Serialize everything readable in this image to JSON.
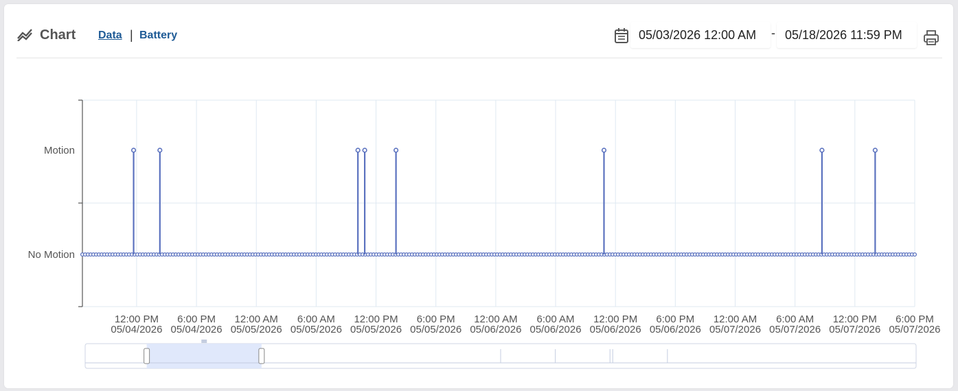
{
  "header": {
    "title": "Chart",
    "tabs": {
      "data": "Data",
      "separator": "|",
      "battery": "Battery"
    },
    "date_start": "05/03/2026 12:00 AM",
    "date_separator": "-",
    "date_end": "05/18/2026 11:59 PM",
    "icons": {
      "chart": "chart-line-icon",
      "calendar": "calendar-icon",
      "print": "print-icon"
    }
  },
  "colors": {
    "series": "#5b72bf",
    "grid": "#dfe9f2",
    "axis": "#555555",
    "link": "#1f5b96",
    "navigator_fill": "#dde6fb"
  },
  "chart_data": {
    "type": "line",
    "step": true,
    "y_categories": [
      "No Motion",
      "Motion"
    ],
    "x_ticks": [
      [
        "12:00 PM",
        "05/04/2026"
      ],
      [
        "6:00 PM",
        "05/04/2026"
      ],
      [
        "12:00 AM",
        "05/05/2026"
      ],
      [
        "6:00 AM",
        "05/05/2026"
      ],
      [
        "12:00 PM",
        "05/05/2026"
      ],
      [
        "6:00 PM",
        "05/05/2026"
      ],
      [
        "12:00 AM",
        "05/06/2026"
      ],
      [
        "6:00 AM",
        "05/06/2026"
      ],
      [
        "12:00 PM",
        "05/06/2026"
      ],
      [
        "6:00 PM",
        "05/06/2026"
      ],
      [
        "12:00 AM",
        "05/07/2026"
      ],
      [
        "6:00 AM",
        "05/07/2026"
      ],
      [
        "12:00 PM",
        "05/07/2026"
      ],
      [
        "6:00 PM",
        "05/07/2026"
      ]
    ],
    "x_range": [
      "05/04/2026 6:34 AM",
      "05/07/2026 6:00 PM"
    ],
    "baseline_value": "No Motion",
    "motion_events": [
      "05/04/2026 11:42 AM",
      "05/04/2026 2:20 PM",
      "05/05/2026 10:11 AM",
      "05/05/2026 10:52 AM",
      "05/05/2026 2:00 PM",
      "05/06/2026 10:51 AM",
      "05/07/2026 8:42 AM",
      "05/07/2026 2:02 PM"
    ],
    "navigator": {
      "selected_range": [
        "05/04/2026",
        "05/06/2026"
      ],
      "spike_dates": [
        "05/11/2026",
        "05/12/2026",
        "05/13/2026",
        "05/13/2026",
        "05/14/2026"
      ]
    },
    "grid": true,
    "legend": "none"
  }
}
